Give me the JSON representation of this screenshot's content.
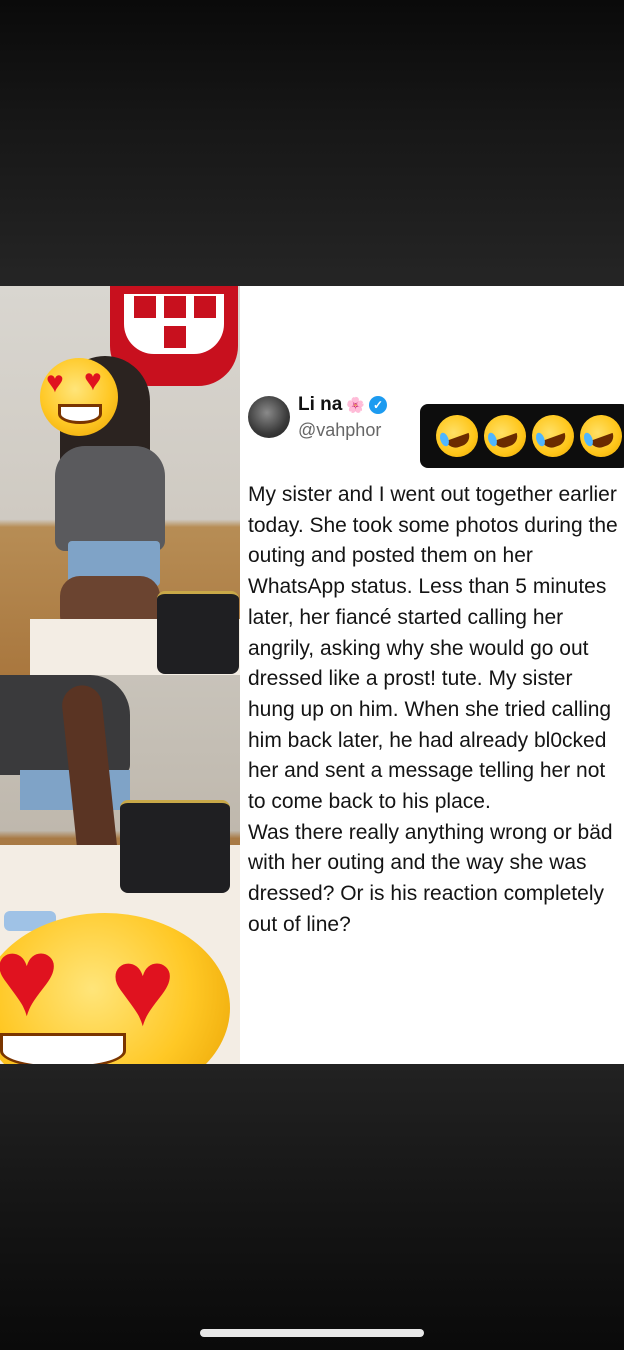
{
  "post": {
    "author_name": "Li na",
    "author_flower": "🌸",
    "verified_mark": "✓",
    "author_handle": "@vahphor",
    "reaction_icons": [
      "rolling-on-floor-laughing-icon",
      "rolling-on-floor-laughing-icon",
      "rolling-on-floor-laughing-icon",
      "rolling-on-floor-laughing-icon"
    ],
    "paragraph_1": "My sister and I went out together earlier today. She took some photos during the outing and posted them on her WhatsApp status. Less than 5 minutes later, her fiancé started calling her angrily, asking why she would go out dressed like a prost! tute. My sister hung up on him. When she tried calling him back later, he had already bl0cked her and sent a message telling her not to come back to his place.",
    "paragraph_2": "Was there really anything wrong or bäd with her outing and the way she was dressed? Or is his reaction completely out of line?"
  },
  "colors": {
    "verified_blue": "#1d9bf0",
    "background_dark": "#0c0c0c"
  }
}
